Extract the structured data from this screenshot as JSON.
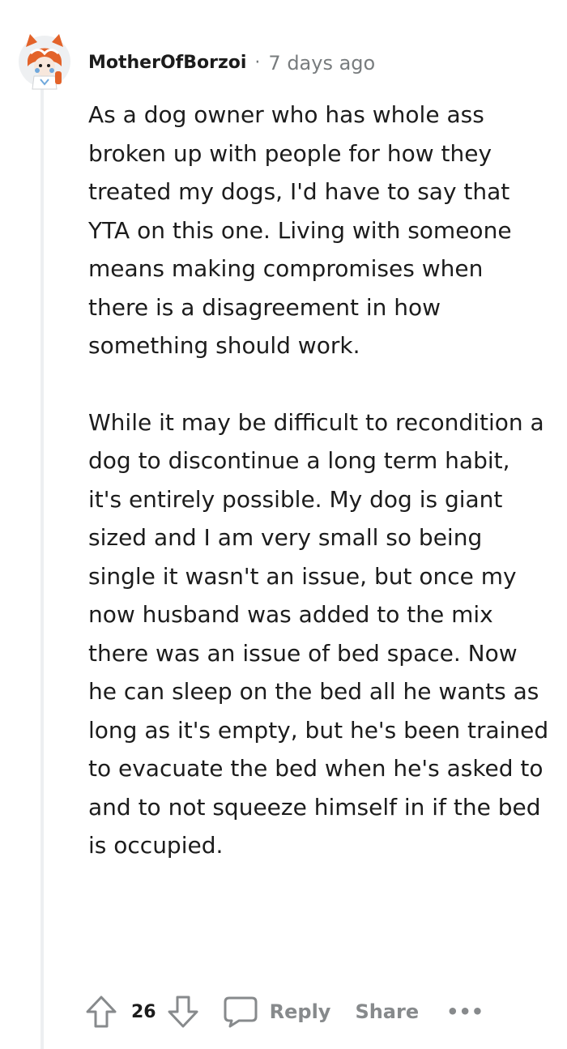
{
  "comment": {
    "username": "MotherOfBorzoi",
    "separator": "·",
    "time": "7 days ago",
    "paragraphs": [
      "As a dog owner who has whole ass broken up with people for how they treated my dogs, I'd have to say that YTA on this one. Living with someone means making compromises when there is a disagreement in how something should work.",
      "While it may be difficult to recondition a dog to discontinue a long term habit, it's entirely possible. My dog is giant sized and I am very small so being single it wasn't an issue, but once my now husband was added to the mix there was an issue of bed space. Now he can sleep on the bed all he wants as long as it's empty, but he's been trained to evacuate the bed when he's asked to and to not squeeze himself in if the bed is occupied."
    ]
  },
  "actions": {
    "score": "26",
    "reply_label": "Reply",
    "share_label": "Share",
    "more_label": "•••"
  },
  "icons": {
    "upvote": "upvote-arrow-icon",
    "downvote": "downvote-arrow-icon",
    "reply": "speech-bubble-icon",
    "avatar": "red-panda-hood-avatar"
  },
  "colors": {
    "text": "#1c1c1c",
    "muted": "#878a8c",
    "thread_line": "#edeff1",
    "avatar_orange": "#e3632a"
  }
}
